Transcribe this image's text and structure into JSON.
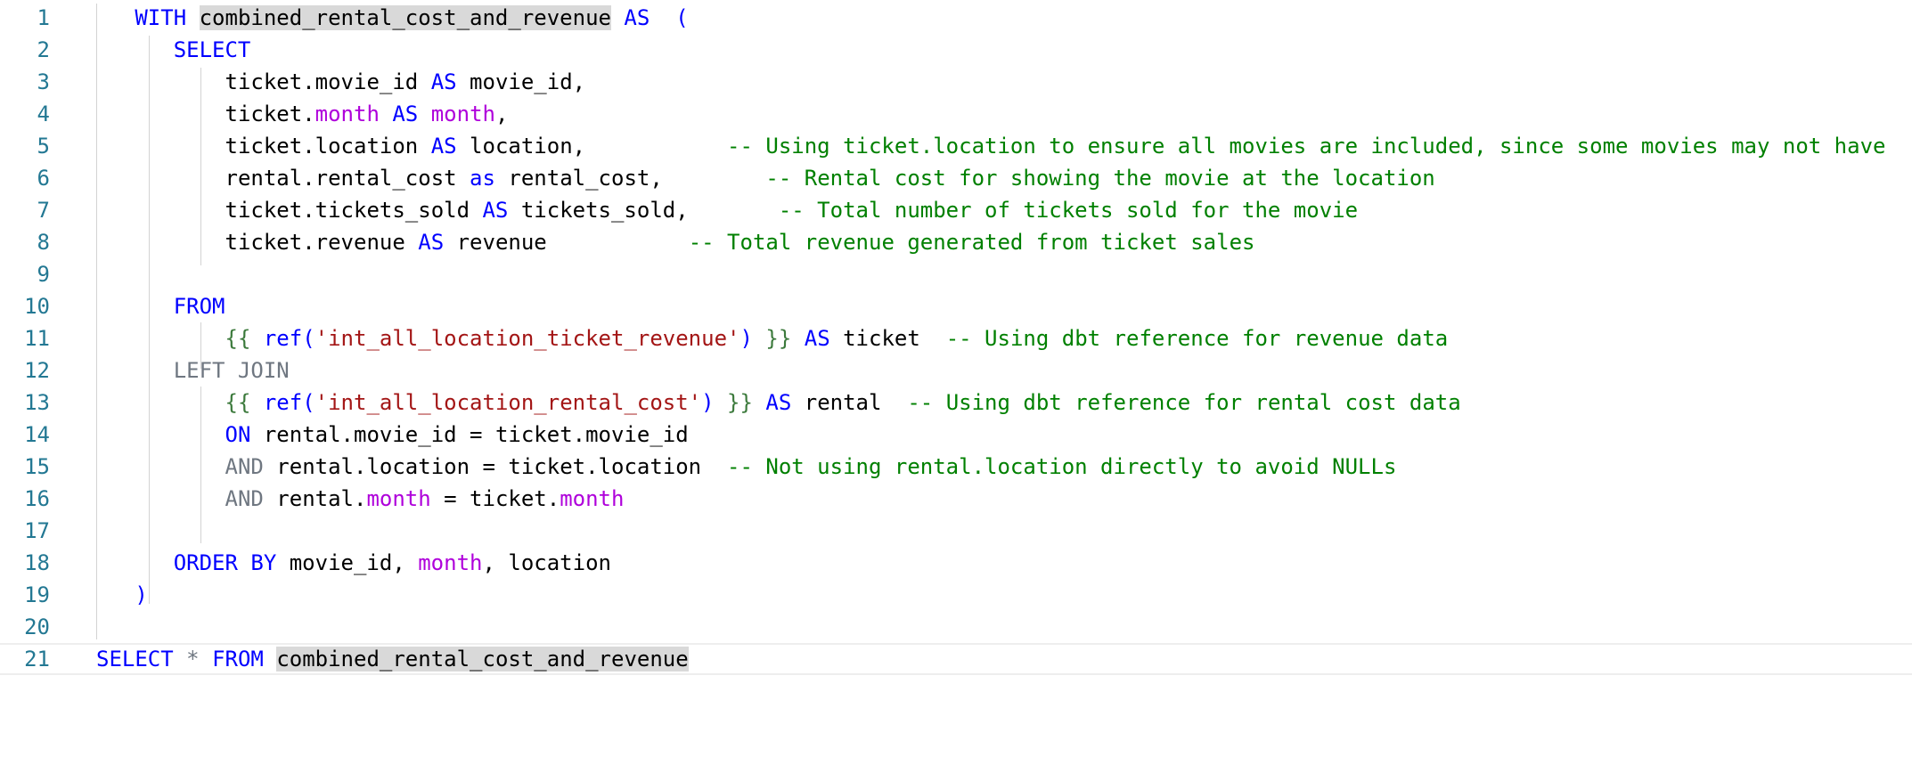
{
  "editor": {
    "language": "SQL (dbt / Jinja)",
    "highlighted_token": "combined_rental_cost_and_revenue",
    "current_line": 21,
    "lines": [
      {
        "n": "1",
        "indent": 3,
        "tokens": [
          [
            "kw",
            "WITH"
          ],
          [
            "",
            "·"
          ],
          [
            "hl",
            "combined_rental_cost_and_revenue"
          ],
          [
            "",
            "·"
          ],
          [
            "kw",
            "AS"
          ],
          [
            "",
            "··"
          ],
          [
            "kw",
            "("
          ]
        ]
      },
      {
        "n": "2",
        "indent": 6,
        "tokens": [
          [
            "kw",
            "SELECT"
          ]
        ]
      },
      {
        "n": "3",
        "indent": 10,
        "tokens": [
          [
            "",
            "ticket.movie_id "
          ],
          [
            "kw",
            "AS"
          ],
          [
            "",
            " movie_id,"
          ]
        ]
      },
      {
        "n": "4",
        "indent": 10,
        "tokens": [
          [
            "",
            "ticket."
          ],
          [
            "var",
            "month"
          ],
          [
            "",
            " "
          ],
          [
            "kw",
            "AS"
          ],
          [
            "",
            " "
          ],
          [
            "var",
            "month"
          ],
          [
            "",
            ","
          ]
        ]
      },
      {
        "n": "5",
        "indent": 10,
        "tokens": [
          [
            "",
            "ticket.location "
          ],
          [
            "kw",
            "AS"
          ],
          [
            "",
            " location,           "
          ],
          [
            "cm",
            "-- Using ticket.location to ensure all movies are included, since some movies may not have"
          ]
        ]
      },
      {
        "n": "6",
        "indent": 10,
        "tokens": [
          [
            "",
            "rental.rental_cost "
          ],
          [
            "kw",
            "as"
          ],
          [
            "",
            " rental_cost,        "
          ],
          [
            "cm",
            "-- Rental cost for showing the movie at the location"
          ]
        ]
      },
      {
        "n": "7",
        "indent": 10,
        "tokens": [
          [
            "",
            "ticket.tickets_sold "
          ],
          [
            "kw",
            "AS"
          ],
          [
            "",
            " tickets_sold,       "
          ],
          [
            "cm",
            "-- Total number of tickets sold for the movie"
          ]
        ]
      },
      {
        "n": "8",
        "indent": 10,
        "tokens": [
          [
            "",
            "ticket.revenue "
          ],
          [
            "kw",
            "AS"
          ],
          [
            "",
            " revenue           "
          ],
          [
            "cm",
            "-- Total revenue generated from ticket sales"
          ]
        ]
      },
      {
        "n": "9",
        "indent": 0,
        "tokens": []
      },
      {
        "n": "10",
        "indent": 6,
        "tokens": [
          [
            "kw",
            "FROM"
          ]
        ]
      },
      {
        "n": "11",
        "indent": 10,
        "tokens": [
          [
            "jin",
            "{{ "
          ],
          [
            "kw",
            "ref("
          ],
          [
            "str",
            "'int_all_location_ticket_revenue'"
          ],
          [
            "kw",
            ")"
          ],
          [
            "jin",
            " }}"
          ],
          [
            "",
            " "
          ],
          [
            "kw",
            "AS"
          ],
          [
            "",
            " ticket  "
          ],
          [
            "cm",
            "-- Using dbt reference for revenue data"
          ]
        ]
      },
      {
        "n": "12",
        "indent": 6,
        "tokens": [
          [
            "op",
            "LEFT JOIN"
          ]
        ]
      },
      {
        "n": "13",
        "indent": 10,
        "tokens": [
          [
            "jin",
            "{{ "
          ],
          [
            "kw",
            "ref("
          ],
          [
            "str",
            "'int_all_location_rental_cost'"
          ],
          [
            "kw",
            ")"
          ],
          [
            "jin",
            " }}"
          ],
          [
            "",
            " "
          ],
          [
            "kw",
            "AS"
          ],
          [
            "",
            " rental  "
          ],
          [
            "cm",
            "-- Using dbt reference for rental cost data"
          ]
        ]
      },
      {
        "n": "14",
        "indent": 10,
        "tokens": [
          [
            "kw",
            "ON"
          ],
          [
            "",
            " rental.movie_id = ticket.movie_id"
          ]
        ]
      },
      {
        "n": "15",
        "indent": 10,
        "tokens": [
          [
            "op",
            "AND"
          ],
          [
            "",
            " rental.location = ticket.location  "
          ],
          [
            "cm",
            "-- Not using rental.location directly to avoid NULLs"
          ]
        ]
      },
      {
        "n": "16",
        "indent": 10,
        "tokens": [
          [
            "op",
            "AND"
          ],
          [
            "",
            " rental."
          ],
          [
            "var",
            "month"
          ],
          [
            "",
            " = ticket."
          ],
          [
            "var",
            "month"
          ]
        ]
      },
      {
        "n": "17",
        "indent": 0,
        "tokens": []
      },
      {
        "n": "18",
        "indent": 6,
        "tokens": [
          [
            "kw",
            "ORDER BY"
          ],
          [
            "",
            " movie_id, "
          ],
          [
            "var",
            "month"
          ],
          [
            "",
            ", location"
          ]
        ]
      },
      {
        "n": "19",
        "indent": 3,
        "tokens": [
          [
            "kw",
            ")"
          ]
        ]
      },
      {
        "n": "20",
        "indent": 0,
        "tokens": []
      },
      {
        "n": "21",
        "indent": 0,
        "tokens": [
          [
            "kw",
            "SELECT"
          ],
          [
            "",
            " "
          ],
          [
            "op",
            "*"
          ],
          [
            "",
            " "
          ],
          [
            "kw",
            "FROM"
          ],
          [
            "",
            " "
          ],
          [
            "hl",
            "combined_rental_cost_and_revenue"
          ]
        ]
      }
    ]
  }
}
